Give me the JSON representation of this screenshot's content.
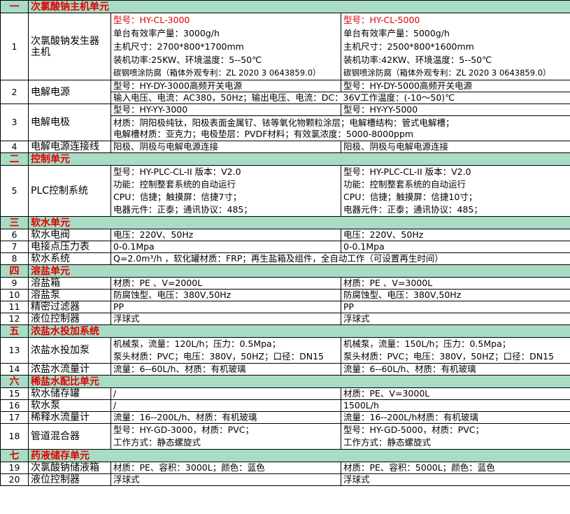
{
  "colors": {
    "section_bg": "#a8dcc4",
    "section_text": "#e00000",
    "model_highlight": "#e00000"
  },
  "sections": [
    {
      "num": "一",
      "title": "次氯酸钠主机单元",
      "rows": [
        {
          "num": "1",
          "name": "次氯酸钠发生器\n主机",
          "a": [
            "型号：HY-CL-3000",
            "单台有效率产量：3000g/h",
            "主机尺寸：2700*800*1700mm",
            "装机功率:25KW、环境温度：5--50℃",
            "碳钢喷涂防腐（箱体外观专利：ZL 2020 3 0643859.0）"
          ],
          "b": [
            "型号：HY-CL-5000",
            "单台有效率产量：5000g/h",
            "主机尺寸：2500*800*1600mm",
            "装机功率:42KW、环境温度：5--50℃",
            "碳钢喷涂防腐（箱体外观专利：ZL 2020 3 0643859.0）"
          ]
        },
        {
          "num": "2",
          "name": "电解电源",
          "a": [
            "型号：HY-DY-3000高频开关电源"
          ],
          "b": [
            "型号：HY-DY-5000高频开关电源"
          ],
          "full": [
            "输入电压、电流：AC380，50Hz；输出电压、电流：DC：36V工作温度：(-10～50)℃"
          ]
        },
        {
          "num": "3",
          "name": "电解电极",
          "a": [
            "型号：HY-YY-3000"
          ],
          "b": [
            "型号：HY-YY-5000"
          ],
          "full": [
            "材质：阴阳极纯钛，阳极表面金属钌、铱等氧化物颗粒涂层；电解槽结构：管式电解槽；",
            "电解槽材质：亚克力；电极垫层：PVDF材料；有效氯浓度：5000-8000ppm"
          ]
        },
        {
          "num": "4",
          "name": "电解电源连接线",
          "a": [
            "阳极、阴极与电解电源连接"
          ],
          "b": [
            "阳极、阴极与电解电源连接"
          ]
        }
      ]
    },
    {
      "num": "二",
      "title": "控制单元",
      "rows": [
        {
          "num": "5",
          "name": "PLC控制系统",
          "a": [
            "型号：HY-PLC-CL-II  版本：V2.0",
            "功能：控制整套系统的自动运行",
            "CPU：信捷；触摸屏：信捷7寸；",
            "电器元件：正泰；通讯协议：485；"
          ],
          "b": [
            "型号：HY-PLC-CL-II  版本：V2.0",
            "功能：控制整套系统的自动运行",
            "CPU：信捷；触摸屏：信捷10寸；",
            "电器元件：正泰；通讯协议：485；"
          ]
        }
      ]
    },
    {
      "num": "三",
      "title": "软水单元",
      "rows": [
        {
          "num": "6",
          "name": "软水电阀",
          "a": [
            "电压：220V、50Hz"
          ],
          "b": [
            "电压：220V、50Hz"
          ]
        },
        {
          "num": "7",
          "name": "电接点压力表",
          "a": [
            "0-0.1Mpa"
          ],
          "b": [
            "0-0.1Mpa"
          ]
        },
        {
          "num": "8",
          "name": "软水系统",
          "full": [
            "Q=2.0m³/h  ，软化罐材质：FRP；再生盐箱及组件，全自动工作（可设置再生时间）"
          ]
        }
      ]
    },
    {
      "num": "四",
      "title": "溶盐单元",
      "rows": [
        {
          "num": "9",
          "name": "溶盐箱",
          "a": [
            "材质：PE 、V=2000L"
          ],
          "b": [
            "材质：PE 、V=3000L"
          ]
        },
        {
          "num": "10",
          "name": "溶盐泵",
          "a": [
            "防腐蚀型、电压：380V,50Hz"
          ],
          "b": [
            "防腐蚀型、电压：380V,50Hz"
          ]
        },
        {
          "num": "11",
          "name": "精密过滤器",
          "a": [
            "PP"
          ],
          "b": [
            "PP"
          ]
        },
        {
          "num": "12",
          "name": "液位控制器",
          "a": [
            "浮球式"
          ],
          "b": [
            "浮球式"
          ]
        }
      ]
    },
    {
      "num": "五",
      "title": "浓盐水投加系统",
      "rows": [
        {
          "num": "13",
          "name": "浓盐水投加泵",
          "a": [
            "机械泵，流量：120L/h；压力：0.5Mpa；",
            "泵头材质：PVC；电压：380V，50HZ；口径：DN15"
          ],
          "b": [
            "机械泵，流量：150L/h；压力：0.5Mpa；",
            "泵头材质：PVC；电压：380V，50HZ；口径：DN15"
          ]
        },
        {
          "num": "14",
          "name": "浓盐水流量计",
          "a": [
            "流量：6--60L/h、材质：有机玻璃"
          ],
          "b": [
            "流量：6--60L/h、材质：有机玻璃"
          ]
        }
      ]
    },
    {
      "num": "六",
      "title": "稀盐水配比单元",
      "rows": [
        {
          "num": "15",
          "name": "软水储存罐",
          "a": [
            "/"
          ],
          "b": [
            "材质：PE、V=3000L"
          ]
        },
        {
          "num": "16",
          "name": "软水泵",
          "a": [
            "/"
          ],
          "b": [
            "1500L/h"
          ]
        },
        {
          "num": "17",
          "name": "稀释水流量计",
          "a": [
            "流量：16--200L/h、材质：有机玻璃"
          ],
          "b": [
            "流量：16--200L/h材质：有机玻璃"
          ]
        },
        {
          "num": "18",
          "name": "管道混合器",
          "a": [
            "型号：HY-GD-3000，材质：PVC；",
            "工作方式：静态螺旋式"
          ],
          "b": [
            "型号：HY-GD-5000，材质：PVC；",
            "工作方式：静态螺旋式"
          ]
        }
      ]
    },
    {
      "num": "七",
      "title": "药液储存单元",
      "rows": [
        {
          "num": "19",
          "name": "次氯酸钠储液箱",
          "a": [
            "材质：PE、容积：3000L；颜色：蓝色"
          ],
          "b": [
            "材质：PE、容积：5000L；颜色：蓝色"
          ]
        },
        {
          "num": "20",
          "name": "液位控制器",
          "a": [
            "浮球式"
          ],
          "b": [
            "浮球式"
          ]
        }
      ]
    }
  ]
}
